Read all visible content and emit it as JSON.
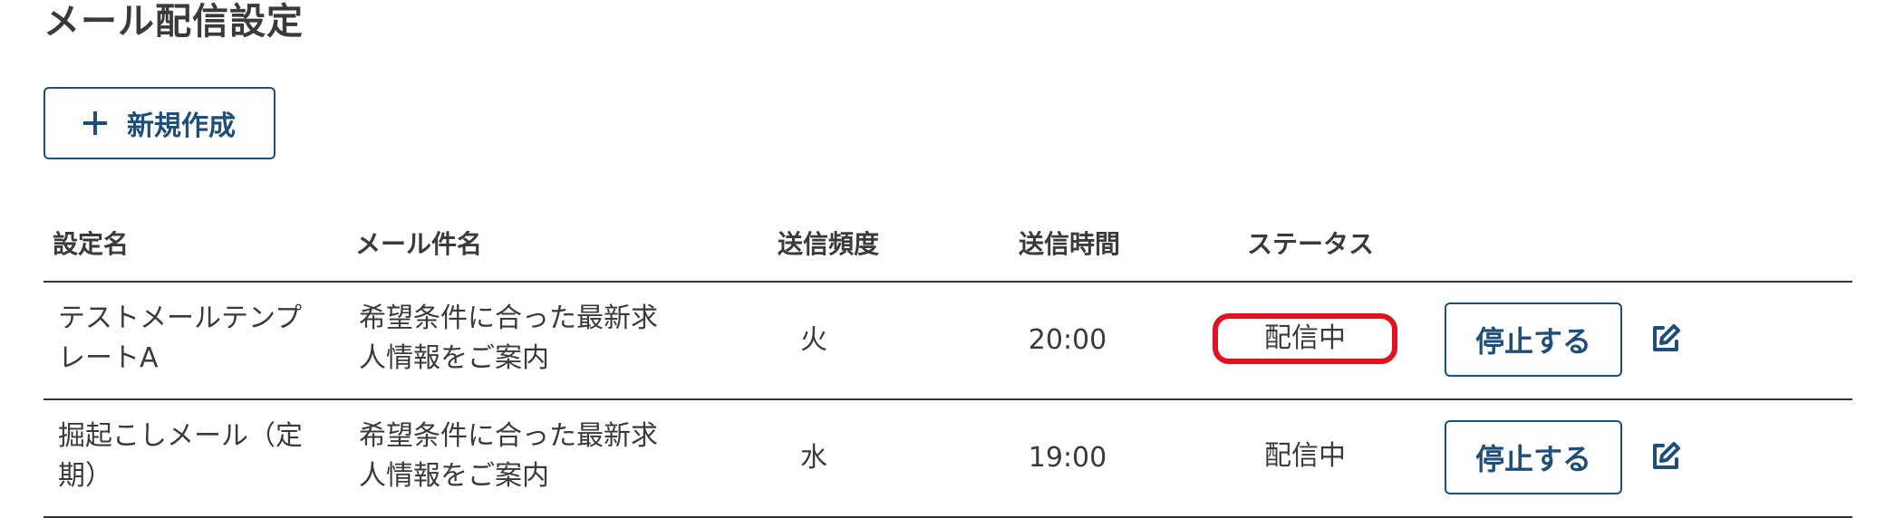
{
  "page": {
    "title": "メール配信設定"
  },
  "toolbar": {
    "new_label": "新規作成",
    "new_icon": "plus-icon"
  },
  "table": {
    "headers": {
      "setting_name": "設定名",
      "mail_subject": "メール件名",
      "frequency": "送信頻度",
      "send_time": "送信時間",
      "status": "ステータス"
    },
    "rows": [
      {
        "setting_name_line1": "テストメールテンプ",
        "setting_name_line2": "レートA",
        "subject_line1": "希望条件に合った最新求",
        "subject_line2": "人情報をご案内",
        "frequency": "火",
        "send_time": "20:00",
        "status": "配信中",
        "status_highlighted": true,
        "stop_label": "停止する",
        "edit_icon": "edit-icon"
      },
      {
        "setting_name_line1": "掘起こしメール（定",
        "setting_name_line2": "期）",
        "subject_line1": "希望条件に合った最新求",
        "subject_line2": "人情報をご案内",
        "frequency": "水",
        "send_time": "19:00",
        "status": "配信中",
        "status_highlighted": false,
        "stop_label": "停止する",
        "edit_icon": "edit-icon"
      }
    ]
  },
  "colors": {
    "accent": "#1f4e79",
    "highlight": "#e3101e",
    "text": "#3a3a3a"
  }
}
